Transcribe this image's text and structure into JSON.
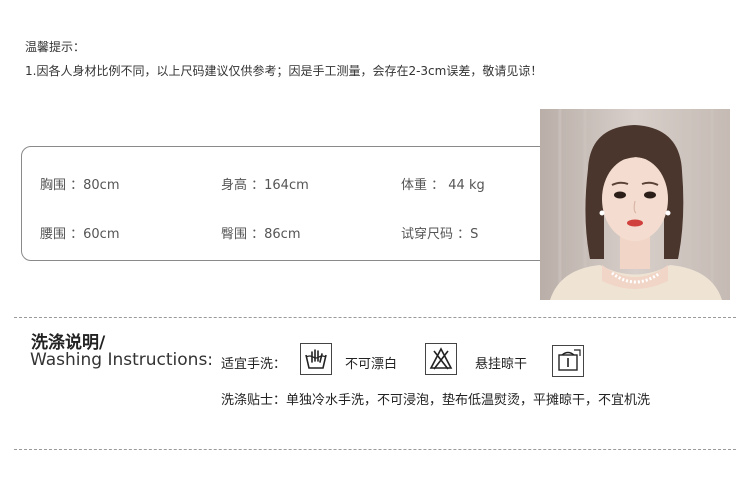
{
  "tips": {
    "title": "温馨提示：",
    "line": "1.因各人身材比例不同，以上尺码建议仅供参考；因是手工测量，会存在2-3cm误差，敬请见谅！"
  },
  "measurements": {
    "chest": "胸围 ：80cm",
    "height": "身高 ：164cm",
    "weight": "体重 ： 44 kg",
    "waist": "腰围 ：60cm",
    "hip": "臀围 ：86cm",
    "size": "试穿尺码 ：S"
  },
  "washing": {
    "title_cn": "洗涤说明/",
    "title_en": "Washing Instructions:",
    "suitable_label": "适宜手洗：",
    "no_bleach": "不可漂白",
    "hang_dry": "悬挂晾干",
    "tips": "洗涤贴士：单独冷水手洗，不可浸泡，垫布低温熨烫，平摊晾干，不宜机洗"
  },
  "icons": [
    "hand-wash-icon",
    "no-bleach-icon",
    "hang-dry-icon"
  ]
}
